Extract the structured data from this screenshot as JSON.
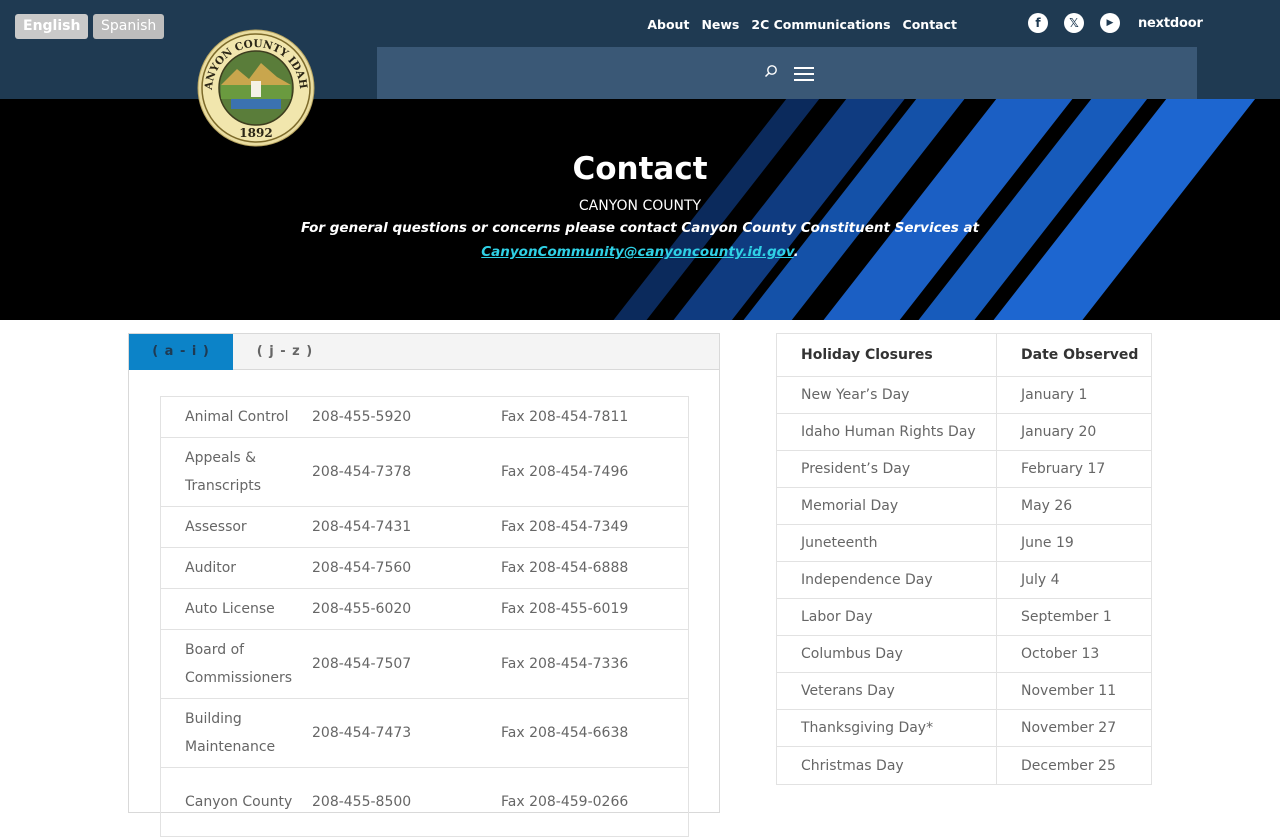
{
  "language": {
    "english": "English",
    "spanish": "Spanish"
  },
  "seal": {
    "text": "CANYON COUNTY IDAHO",
    "year": "1892"
  },
  "topnav": {
    "items": [
      "About",
      "News",
      "2C Communications",
      "Contact"
    ]
  },
  "social": {
    "facebook": "f",
    "x": "𝕏",
    "youtube": "▶",
    "nextdoor": "nextdoor"
  },
  "colors": {
    "header": "#1f3a52",
    "nav_box": "#3a5876",
    "tab_active": "#0c83c8",
    "link": "#2fd1e6"
  },
  "hero": {
    "title": "Contact",
    "county": "CANYON COUNTY",
    "note": "For general questions or concerns please contact Canyon County Constituent Services at",
    "email": "CanyonCommunity@canyoncounty.id.gov",
    "email_suffix": "."
  },
  "tabs": [
    {
      "label": "( a - i )",
      "active": true
    },
    {
      "label": "( j - z )",
      "active": false
    }
  ],
  "departments": [
    {
      "name": "Animal Control",
      "phone": "208-455-5920",
      "fax": "Fax 208-454-7811"
    },
    {
      "name": "Appeals & Transcripts",
      "phone": "208-454-7378",
      "fax": "Fax 208-454-7496"
    },
    {
      "name": "Assessor",
      "phone": "208-454-7431",
      "fax": "Fax 208-454-7349"
    },
    {
      "name": "Auditor",
      "phone": "208-454-7560",
      "fax": "Fax 208-454-6888"
    },
    {
      "name": "Auto License",
      "phone": "208-455-6020",
      "fax": "Fax 208-455-6019"
    },
    {
      "name": "Board of Commissioners",
      "phone": "208-454-7507",
      "fax": "Fax 208-454-7336"
    },
    {
      "name": "Building Maintenance",
      "phone": "208-454-7473",
      "fax": "Fax 208-454-6638"
    },
    {
      "name": "Canyon County",
      "phone": "208-455-8500",
      "fax": "Fax 208-459-0266"
    }
  ],
  "holidays": {
    "headers": [
      "Holiday Closures",
      "Date Observed"
    ],
    "rows": [
      [
        "New Year’s Day",
        "January 1"
      ],
      [
        "Idaho Human Rights Day",
        "January 20"
      ],
      [
        "President’s Day",
        "February 17"
      ],
      [
        "Memorial Day",
        "May 26"
      ],
      [
        "Juneteenth",
        "June 19"
      ],
      [
        "Independence Day",
        "July 4"
      ],
      [
        "Labor Day",
        "September 1"
      ],
      [
        "Columbus Day",
        "October 13"
      ],
      [
        "Veterans Day",
        "November 11"
      ],
      [
        "Thanksgiving Day*",
        "November 27"
      ],
      [
        "Christmas Day",
        "December 25"
      ]
    ]
  }
}
